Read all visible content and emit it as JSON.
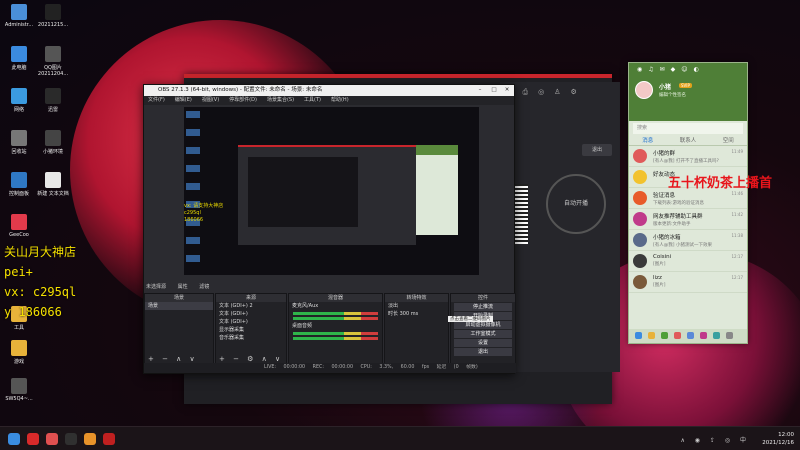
{
  "desktop_icons": [
    {
      "label": "Administr...",
      "color": "#4a8fd8"
    },
    {
      "label": "20211215...",
      "color": "#222"
    },
    {
      "label": "此电脑",
      "color": "#3b8be0"
    },
    {
      "label": "QQ图片20211204...",
      "color": "#555"
    },
    {
      "label": "网络",
      "color": "#3b9be0"
    },
    {
      "label": "迅雷",
      "color": "#2a2a2a"
    },
    {
      "label": "回收站",
      "color": "#777"
    },
    {
      "label": "小猪环境",
      "color": "#444"
    },
    {
      "label": "控制面板",
      "color": "#2f78c4"
    },
    {
      "label": "新建 文本文档",
      "color": "#e8e8e8"
    },
    {
      "label": "GeeCoo",
      "color": "#e23a4b"
    },
    {
      "label": "工具",
      "color": "#e8b23a"
    },
    {
      "label": "游戏",
      "color": "#e8b23a"
    },
    {
      "label": "SW5Q4~...",
      "color": "#555"
    }
  ],
  "promo": {
    "left_lines": [
      "关山月大神店",
      "pei+",
      "vx: c295ql",
      "y 186066"
    ],
    "right": "五十杯奶茶上播首"
  },
  "obs": {
    "title": "OBS 27.1.3 (64-bit, windows) - 配置文件: 未命名 - 场景: 未命名",
    "menu": [
      "文件(F)",
      "编辑(E)",
      "视图(V)",
      "停靠部件(D)",
      "场景集合(S)",
      "工具(T)",
      "帮助(H)"
    ],
    "title_buttons": [
      "–",
      "□",
      "✕"
    ],
    "scene_bar": [
      "未选择源",
      "属性",
      "滤镜"
    ],
    "docks": {
      "scenes": {
        "header": "场景",
        "items": [
          "场景"
        ],
        "footer": "+ − ∧ ∨"
      },
      "sources": {
        "header": "来源",
        "items": [
          "文本 (GDI+) 2",
          "文本 (GDI+)",
          "文本 (GDI+)",
          "显示器采集",
          "音乐器采集"
        ],
        "footer": "+ − ⚙ ∧ ∨"
      },
      "mixer": {
        "header": "混音器",
        "items": [
          "麦克风/Aux",
          "桌面音频"
        ]
      },
      "transitions": {
        "header": "转场特效",
        "items": [
          "淡出",
          "时长  300 ms"
        ]
      },
      "controls": {
        "header": "控件",
        "buttons": [
          "停止推流",
          "开始录制",
          "启动虚拟摄像机",
          "工作室模式",
          "设置",
          "退出"
        ]
      }
    },
    "status": "LIVE: 00:00:00   REC: 00:00:00   CPU: 3.3%, 60.00 fps   延迟 (0 帧数)",
    "preview_lines": [
      "vx: 请支持大神店",
      "c295ql",
      "186066"
    ],
    "preview_tooltip": "点击查看二维码图片"
  },
  "live_panel": {
    "exit_label": "退出",
    "ring_label": "自动开播",
    "icons": [
      "⌂",
      "⎙",
      "◎",
      "♙",
      "⚙"
    ]
  },
  "chat": {
    "topbar": [
      "◉",
      "♫",
      "✉",
      "◆",
      "☺",
      "◐"
    ],
    "nickname": "小猪",
    "vip": "SVIP",
    "signature": "编辑个性签名",
    "search_placeholder": "搜索",
    "tabs": [
      "消息",
      "联系人",
      "空间"
    ],
    "items": [
      {
        "name": "小猪的群",
        "msg": "[有人@我] 打开不了直播工具吗?",
        "time": "11:49",
        "color": "#e05a5a"
      },
      {
        "name": "好友动态",
        "msg": "",
        "time": "",
        "color": "#f2c22e"
      },
      {
        "name": "验证消息",
        "msg": "下载列表:游戏的验证消息",
        "time": "11:46",
        "color": "#e85a2a"
      },
      {
        "name": "网友推荐辅助工具群",
        "msg": "版本更新:文件助手",
        "time": "11:42",
        "color": "#c03a8a"
      },
      {
        "name": "小猪的冰箱",
        "msg": "[有人@我] 小猪测试一下效果",
        "time": "11:38",
        "color": "#5a6a8a"
      },
      {
        "name": "Coisini",
        "msg": "[图片]",
        "time": "12:17",
        "color": "#3a3a3a"
      },
      {
        "name": "lizz",
        "msg": "[图片]",
        "time": "12:17",
        "color": "#7a5a3a"
      }
    ],
    "foot_colors": [
      "#3b8be0",
      "#e8b23a",
      "#4f9f37",
      "#e05a5a",
      "#5a8ad8",
      "#c03a8a",
      "#3aa0a0",
      "#888888"
    ]
  },
  "taskbar": {
    "icons": [
      {
        "name": "start-icon",
        "color": "#3a8de0"
      },
      {
        "name": "app-netease-icon",
        "color": "#d82a2a"
      },
      {
        "name": "app-shield-icon",
        "color": "#e05050"
      },
      {
        "name": "app-obs-icon",
        "color": "#303030"
      },
      {
        "name": "app-orange-icon",
        "color": "#e8932a"
      },
      {
        "name": "app-red-icon",
        "color": "#c02020"
      }
    ],
    "tray": "∧ ◉ ⇪ ◎ 中",
    "time": "12:00",
    "date": "2021/12/16"
  }
}
